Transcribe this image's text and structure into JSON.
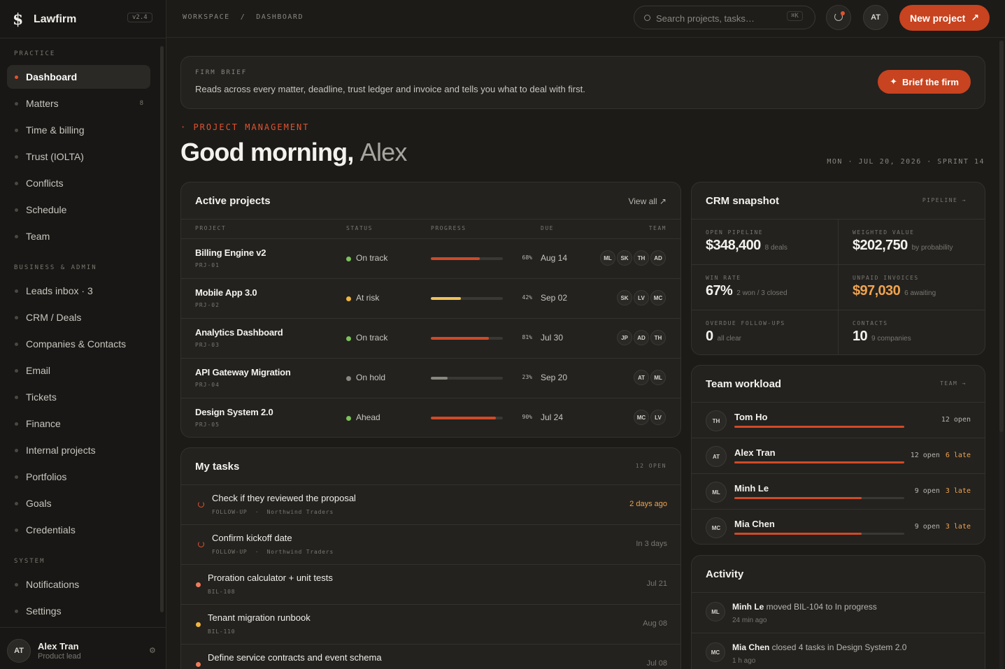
{
  "app": {
    "name": "Lawfirm",
    "version": "v2.4"
  },
  "sidebar": {
    "sections": [
      {
        "title": "PRACTICE"
      },
      {
        "title": "BUSINESS & ADMIN"
      },
      {
        "title": "SYSTEM"
      }
    ],
    "items": [
      {
        "label": "Dashboard",
        "active": true
      },
      {
        "label": "Matters",
        "count": "8"
      },
      {
        "label": "Time & billing"
      },
      {
        "label": "Trust (IOLTA)"
      },
      {
        "label": "Conflicts"
      },
      {
        "label": "Schedule"
      },
      {
        "label": "Team"
      },
      {
        "label": "Leads inbox · 3"
      },
      {
        "label": "CRM / Deals"
      },
      {
        "label": "Companies & Contacts"
      },
      {
        "label": "Email"
      },
      {
        "label": "Tickets"
      },
      {
        "label": "Finance"
      },
      {
        "label": "Internal projects"
      },
      {
        "label": "Portfolios"
      },
      {
        "label": "Goals"
      },
      {
        "label": "Credentials"
      },
      {
        "label": "Notifications"
      },
      {
        "label": "Settings"
      }
    ],
    "user": {
      "initials": "AT",
      "name": "Alex Tran",
      "role": "Product lead"
    }
  },
  "topbar": {
    "breadcrumb": "WORKSPACE  /  DASHBOARD",
    "search_placeholder": "Search projects, tasks…",
    "search_shortcut": "⌘K",
    "avatar": "AT",
    "new_project": "New project",
    "new_project_arrow": "↗"
  },
  "brief": {
    "label": "FIRM BRIEF",
    "text": "Reads across every matter, deadline, trust ledger and invoice and tells you what to deal with first.",
    "button": "Brief the firm",
    "button_icon": "✦"
  },
  "header": {
    "eyebrow": "· PROJECT MANAGEMENT",
    "greeting": "Good morning, ",
    "name": "Alex",
    "date": "MON · JUL 20, 2026 · SPRINT 14"
  },
  "projects": {
    "title": "Active projects",
    "view_all": "View all ↗",
    "columns": [
      "PROJECT",
      "STATUS",
      "PROGRESS",
      "DUE",
      "TEAM"
    ],
    "rows": [
      {
        "name": "Billing Engine v2",
        "id": "PRJ-01",
        "status": "On track",
        "status_color": "#7bc25a",
        "progress": 68,
        "progress_label": "68%",
        "bar_color": "#d04a27",
        "due": "Aug 14",
        "team": [
          "ML",
          "SK",
          "TH",
          "AD"
        ]
      },
      {
        "name": "Mobile App 3.0",
        "id": "PRJ-02",
        "status": "At risk",
        "status_color": "#f0b541",
        "progress": 42,
        "progress_label": "42%",
        "bar_color": "#f0c25a",
        "due": "Sep 02",
        "team": [
          "SK",
          "LV",
          "MC"
        ]
      },
      {
        "name": "Analytics Dashboard",
        "id": "PRJ-03",
        "status": "On track",
        "status_color": "#7bc25a",
        "progress": 81,
        "progress_label": "81%",
        "bar_color": "#d04a27",
        "due": "Jul 30",
        "team": [
          "JP",
          "AD",
          "TH"
        ]
      },
      {
        "name": "API Gateway Migration",
        "id": "PRJ-04",
        "status": "On hold",
        "status_color": "#8a877f",
        "progress": 23,
        "progress_label": "23%",
        "bar_color": "#8a877f",
        "due": "Sep 20",
        "team": [
          "AT",
          "ML"
        ]
      },
      {
        "name": "Design System 2.0",
        "id": "PRJ-05",
        "status": "Ahead",
        "status_color": "#7bc25a",
        "progress": 90,
        "progress_label": "90%",
        "bar_color": "#d04a27",
        "due": "Jul 24",
        "team": [
          "MC",
          "LV"
        ]
      }
    ]
  },
  "tasks": {
    "title": "My tasks",
    "count": "12 OPEN",
    "rows": [
      {
        "name": "Check if they reviewed the proposal",
        "meta": "FOLLOW-UP  ·  Northwind Traders",
        "when": "2 days ago",
        "when_color": "#f0a34f",
        "icon": "clock"
      },
      {
        "name": "Confirm kickoff date",
        "meta": "FOLLOW-UP  ·  Northwind Traders",
        "when": "In 3 days",
        "when_color": "#7a776f",
        "icon": "clock"
      },
      {
        "name": "Proration calculator + unit tests",
        "meta": "BIL-108",
        "when": "Jul 21",
        "when_color": "#7a776f",
        "icon": "dot",
        "dot_color": "#f07b5a"
      },
      {
        "name": "Tenant migration runbook",
        "meta": "BIL-110",
        "when": "Aug 08",
        "when_color": "#7a776f",
        "icon": "dot",
        "dot_color": "#f0b541"
      },
      {
        "name": "Define service contracts and event schema",
        "meta": "",
        "when": "Jul 08",
        "when_color": "#7a776f",
        "icon": "dot",
        "dot_color": "#f07b5a"
      }
    ]
  },
  "crm": {
    "title": "CRM snapshot",
    "link": "PIPELINE →",
    "kpis": [
      {
        "label": "OPEN PIPELINE",
        "value": "$348,400",
        "sub": "8 deals",
        "color": "#f4f2ed"
      },
      {
        "label": "WEIGHTED VALUE",
        "value": "$202,750",
        "sub": "by probability",
        "color": "#f4f2ed"
      },
      {
        "label": "WIN RATE",
        "value": "67%",
        "sub": "2 won / 3 closed",
        "color": "#f4f2ed"
      },
      {
        "label": "UNPAID INVOICES",
        "value": "$97,030",
        "sub": "6 awaiting",
        "color": "#f0a34f"
      },
      {
        "label": "OVERDUE FOLLOW-UPS",
        "value": "0",
        "sub": "all clear",
        "color": "#f4f2ed"
      },
      {
        "label": "CONTACTS",
        "value": "10",
        "sub": "9 companies",
        "color": "#f4f2ed"
      }
    ]
  },
  "workload": {
    "title": "Team workload",
    "link": "TEAM →",
    "rows": [
      {
        "initials": "TH",
        "name": "Tom Ho",
        "load": 1.0,
        "open": "12 open",
        "late": ""
      },
      {
        "initials": "AT",
        "name": "Alex Tran",
        "load": 1.0,
        "open": "12 open",
        "late": "6 late"
      },
      {
        "initials": "ML",
        "name": "Minh Le",
        "load": 0.75,
        "open": "9 open",
        "late": "3 late"
      },
      {
        "initials": "MC",
        "name": "Mia Chen",
        "load": 0.75,
        "open": "9 open",
        "late": "3 late"
      }
    ]
  },
  "activity": {
    "title": "Activity",
    "rows": [
      {
        "initials": "ML",
        "actor": "Minh Le",
        "action": " moved BIL-104 to In progress",
        "time": "24 min ago"
      },
      {
        "initials": "MC",
        "actor": "Mia Chen",
        "action": " closed 4 tasks in Design System 2.0",
        "time": "1 h ago"
      }
    ]
  }
}
